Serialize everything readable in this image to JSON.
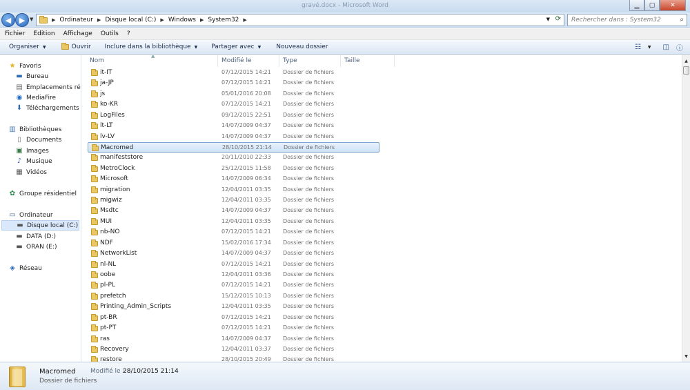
{
  "window": {
    "title": "gravé.docx - Microsoft Word"
  },
  "address": {
    "crumbs": [
      "Ordinateur",
      "Disque local (C:)",
      "Windows",
      "System32"
    ],
    "search_placeholder": "Rechercher dans : System32"
  },
  "menu": [
    "Fichier",
    "Edition",
    "Affichage",
    "Outils",
    "?"
  ],
  "toolbar": {
    "organize": "Organiser",
    "open": "Ouvrir",
    "include": "Inclure dans la bibliothèque",
    "share": "Partager avec",
    "new_folder": "Nouveau dossier"
  },
  "sidebar": {
    "favorites": "Favoris",
    "favorites_items": [
      "Bureau",
      "Emplacements récents",
      "MediaFire",
      "Téléchargements"
    ],
    "libraries": "Bibliothèques",
    "libraries_items": [
      "Documents",
      "Images",
      "Musique",
      "Vidéos"
    ],
    "homegroup": "Groupe résidentiel",
    "computer": "Ordinateur",
    "computer_items": [
      "Disque local (C:)",
      "DATA (D:)",
      "ORAN (E:)"
    ],
    "network": "Réseau"
  },
  "columns": {
    "name": "Nom",
    "modified": "Modifié le",
    "type": "Type",
    "size": "Taille"
  },
  "files": [
    {
      "name": "it-IT",
      "date": "07/12/2015 14:21",
      "type": "Dossier de fichiers"
    },
    {
      "name": "ja-JP",
      "date": "07/12/2015 14:21",
      "type": "Dossier de fichiers"
    },
    {
      "name": "js",
      "date": "05/01/2016 20:08",
      "type": "Dossier de fichiers"
    },
    {
      "name": "ko-KR",
      "date": "07/12/2015 14:21",
      "type": "Dossier de fichiers"
    },
    {
      "name": "LogFiles",
      "date": "09/12/2015 22:51",
      "type": "Dossier de fichiers"
    },
    {
      "name": "lt-LT",
      "date": "14/07/2009 04:37",
      "type": "Dossier de fichiers"
    },
    {
      "name": "lv-LV",
      "date": "14/07/2009 04:37",
      "type": "Dossier de fichiers"
    },
    {
      "name": "Macromed",
      "date": "28/10/2015 21:14",
      "type": "Dossier de fichiers",
      "selected": true
    },
    {
      "name": "manifeststore",
      "date": "20/11/2010 22:33",
      "type": "Dossier de fichiers"
    },
    {
      "name": "MetroClock",
      "date": "25/12/2015 11:58",
      "type": "Dossier de fichiers"
    },
    {
      "name": "Microsoft",
      "date": "14/07/2009 06:34",
      "type": "Dossier de fichiers"
    },
    {
      "name": "migration",
      "date": "12/04/2011 03:35",
      "type": "Dossier de fichiers"
    },
    {
      "name": "migwiz",
      "date": "12/04/2011 03:35",
      "type": "Dossier de fichiers"
    },
    {
      "name": "Msdtc",
      "date": "14/07/2009 04:37",
      "type": "Dossier de fichiers"
    },
    {
      "name": "MUI",
      "date": "12/04/2011 03:35",
      "type": "Dossier de fichiers"
    },
    {
      "name": "nb-NO",
      "date": "07/12/2015 14:21",
      "type": "Dossier de fichiers"
    },
    {
      "name": "NDF",
      "date": "15/02/2016 17:34",
      "type": "Dossier de fichiers"
    },
    {
      "name": "NetworkList",
      "date": "14/07/2009 04:37",
      "type": "Dossier de fichiers"
    },
    {
      "name": "nl-NL",
      "date": "07/12/2015 14:21",
      "type": "Dossier de fichiers"
    },
    {
      "name": "oobe",
      "date": "12/04/2011 03:36",
      "type": "Dossier de fichiers"
    },
    {
      "name": "pl-PL",
      "date": "07/12/2015 14:21",
      "type": "Dossier de fichiers"
    },
    {
      "name": "prefetch",
      "date": "15/12/2015 10:13",
      "type": "Dossier de fichiers"
    },
    {
      "name": "Printing_Admin_Scripts",
      "date": "12/04/2011 03:35",
      "type": "Dossier de fichiers"
    },
    {
      "name": "pt-BR",
      "date": "07/12/2015 14:21",
      "type": "Dossier de fichiers"
    },
    {
      "name": "pt-PT",
      "date": "07/12/2015 14:21",
      "type": "Dossier de fichiers"
    },
    {
      "name": "ras",
      "date": "14/07/2009 04:37",
      "type": "Dossier de fichiers"
    },
    {
      "name": "Recovery",
      "date": "12/04/2011 03:37",
      "type": "Dossier de fichiers"
    },
    {
      "name": "restore",
      "date": "28/10/2015 20:49",
      "type": "Dossier de fichiers"
    }
  ],
  "details": {
    "name": "Macromed",
    "type": "Dossier de fichiers",
    "modified_label": "Modifié le :",
    "modified_value": "28/10/2015 21:14"
  },
  "colors": {
    "selection": "#cfe2f8",
    "folder": "#e9c765",
    "accent": "#2b67b9"
  }
}
